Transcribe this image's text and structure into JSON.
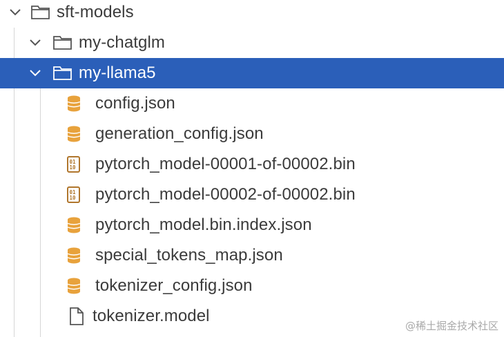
{
  "tree": {
    "root": {
      "label": "sft-models",
      "icon": "folder-icon"
    },
    "folders": [
      {
        "label": "my-chatglm",
        "icon": "folder-icon",
        "selected": false
      },
      {
        "label": "my-llama5",
        "icon": "folder-icon",
        "selected": true
      }
    ],
    "files": [
      {
        "label": "config.json",
        "icon": "json-database-icon"
      },
      {
        "label": "generation_config.json",
        "icon": "json-database-icon"
      },
      {
        "label": "pytorch_model-00001-of-00002.bin",
        "icon": "binary-file-icon"
      },
      {
        "label": "pytorch_model-00002-of-00002.bin",
        "icon": "binary-file-icon"
      },
      {
        "label": "pytorch_model.bin.index.json",
        "icon": "json-database-icon"
      },
      {
        "label": "special_tokens_map.json",
        "icon": "json-database-icon"
      },
      {
        "label": "tokenizer_config.json",
        "icon": "json-database-icon"
      },
      {
        "label": "tokenizer.model",
        "icon": "document-file-icon"
      }
    ]
  },
  "watermark": "@稀土掘金技术社区",
  "colors": {
    "selection": "#2b5fb9",
    "text": "#3b3b3b",
    "json_icon": "#e8a23c",
    "bin_icon": "#b0762c"
  }
}
